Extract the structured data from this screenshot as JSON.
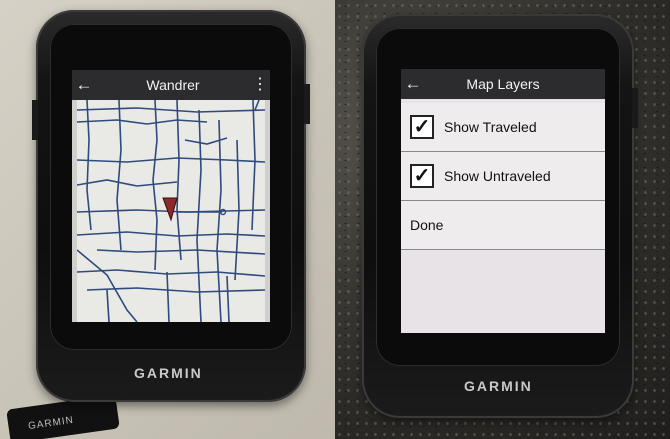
{
  "left": {
    "title": "Wandrer",
    "back_icon": "back-arrow-icon",
    "menu_icon": "more-vertical-icon",
    "brand": "GARMIN",
    "strap_text": "GARMIN"
  },
  "right": {
    "title": "Map Layers",
    "back_icon": "back-arrow-icon",
    "items": [
      {
        "label": "Show Traveled",
        "checked": true
      },
      {
        "label": "Show Untraveled",
        "checked": true
      }
    ],
    "done_label": "Done",
    "brand": "GARMIN"
  }
}
